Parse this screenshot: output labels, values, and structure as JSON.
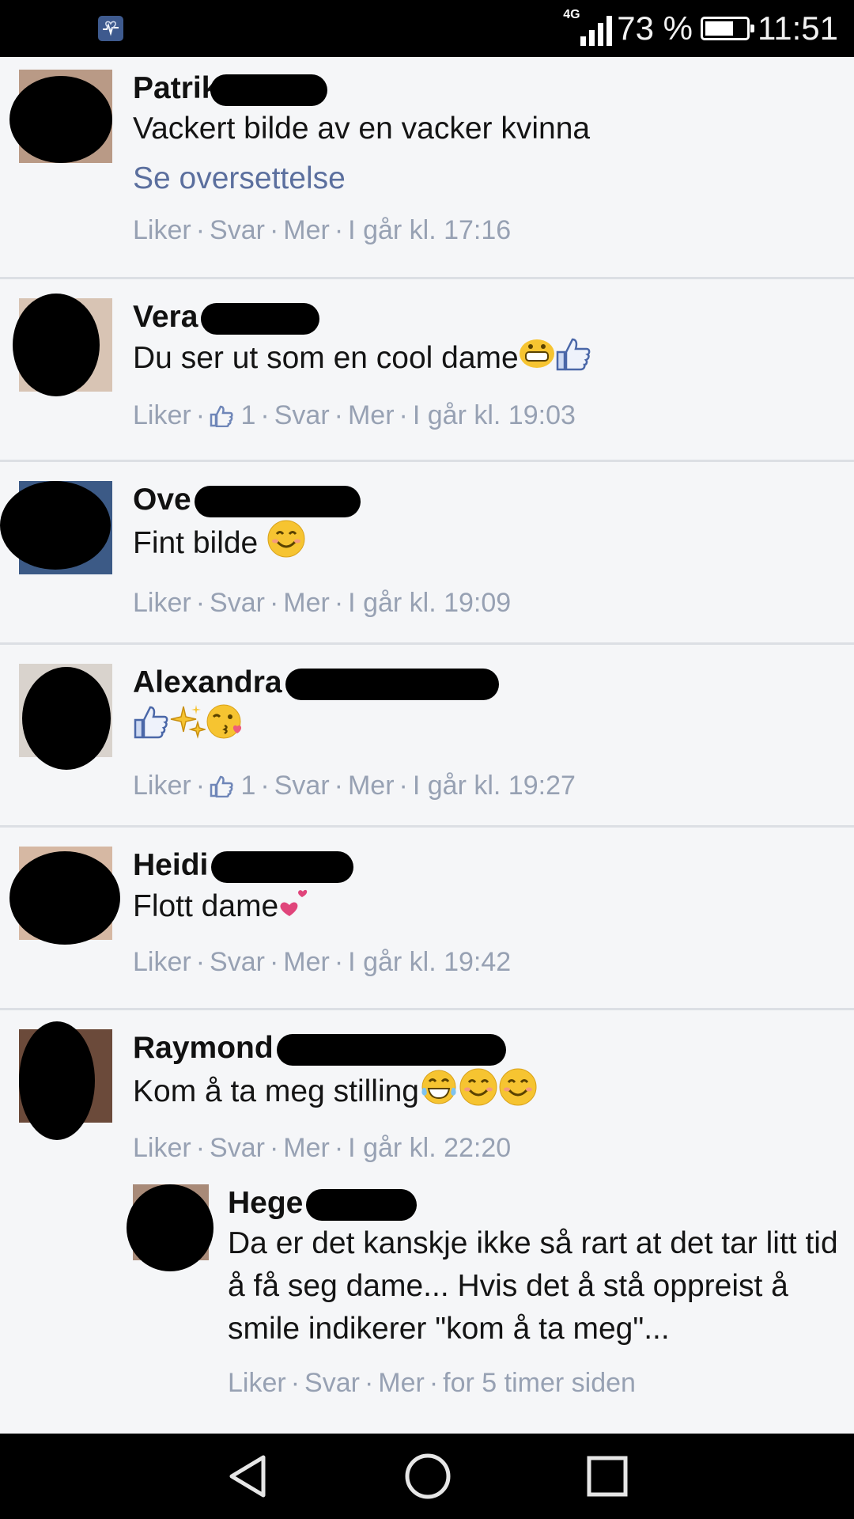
{
  "status": {
    "network": "4G",
    "battery": "73 %",
    "time": "11:51"
  },
  "comments": [
    {
      "name": "Patrik",
      "text": "Vackert bilde av en vacker kvinna",
      "translate": "Se oversettelse",
      "like": "Liker",
      "reply": "Svar",
      "more": "Mer",
      "time": "I går kl. 17:16"
    },
    {
      "name": "Vera",
      "text": "Du ser ut som en cool dame",
      "like": "Liker",
      "likes": "1",
      "reply": "Svar",
      "more": "Mer",
      "time": "I går kl. 19:03"
    },
    {
      "name": "Ove",
      "text": "Fint bilde",
      "like": "Liker",
      "reply": "Svar",
      "more": "Mer",
      "time": "I går kl. 19:09"
    },
    {
      "name": "Alexandra",
      "text": "",
      "like": "Liker",
      "likes": "1",
      "reply": "Svar",
      "more": "Mer",
      "time": "I går kl. 19:27"
    },
    {
      "name": "Heidi",
      "text": "Flott dame",
      "like": "Liker",
      "reply": "Svar",
      "more": "Mer",
      "time": "I går kl. 19:42"
    },
    {
      "name": "Raymond",
      "text": "Kom å ta meg stilling",
      "like": "Liker",
      "reply": "Svar",
      "more": "Mer",
      "time": "I går kl. 22:20"
    }
  ],
  "reply": {
    "name": "Hege",
    "text": "Da er det kanskje ikke så rart at det tar litt tid å få seg dame... Hvis det å stå oppreist å smile indikerer \"kom å ta meg\"...",
    "like": "Liker",
    "reply_label": "Svar",
    "more": "Mer",
    "time": "for 5 timer siden"
  },
  "colors": {
    "link": "#5b6f9e",
    "meta": "#97a1b3",
    "background": "#f5f6f8"
  }
}
